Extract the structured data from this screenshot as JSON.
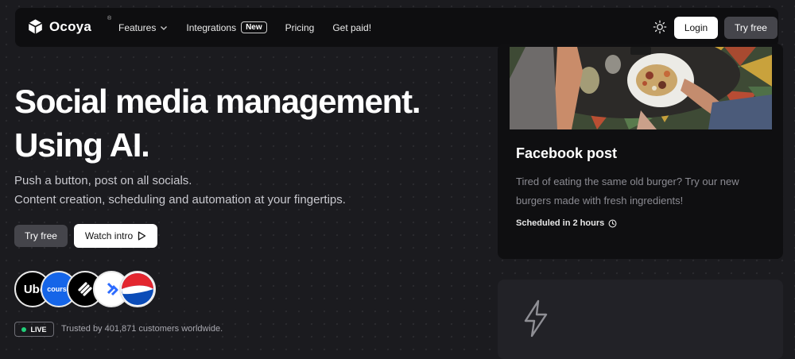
{
  "nav": {
    "logo": "Ocoya",
    "logo_mark": "®",
    "links": [
      "Features",
      "Integrations",
      "Pricing",
      "Get paid!"
    ],
    "new_badge": "New",
    "login": "Login",
    "try_free": "Try free"
  },
  "hero": {
    "title_line1": "Social media management.",
    "title_line2": "Using AI.",
    "subtitle_line1": "Push a button, post on all socials.",
    "subtitle_line2": "Content creation, scheduling and automation at your fingertips.",
    "try_free": "Try free",
    "watch_intro": "Watch intro"
  },
  "customers": {
    "logos": [
      "Uber",
      "course",
      "squarespace",
      "toptal",
      "Pepsi"
    ],
    "uber_text": "Ube",
    "course_text": "course",
    "live": "LIVE",
    "trusted": "Trusted by 401,871 customers worldwide."
  },
  "card": {
    "title": "Facebook post",
    "desc_line1": "Tired of eating the same old burger? Try our new",
    "desc_line2": "burgers made with fresh ingredients!",
    "scheduled": "Scheduled in 2 hours"
  },
  "icons": {
    "logo": "cube-icon",
    "theme": "sun-icon",
    "chevron": "chevron-down-icon",
    "play": "play-icon",
    "clock": "clock-icon",
    "bolt": "lightning-icon"
  },
  "colors": {
    "background": "#1b1b1f",
    "nav_bg": "#0e0e10",
    "card_bg": "#0f0f11",
    "live_dot": "#21d07a"
  }
}
